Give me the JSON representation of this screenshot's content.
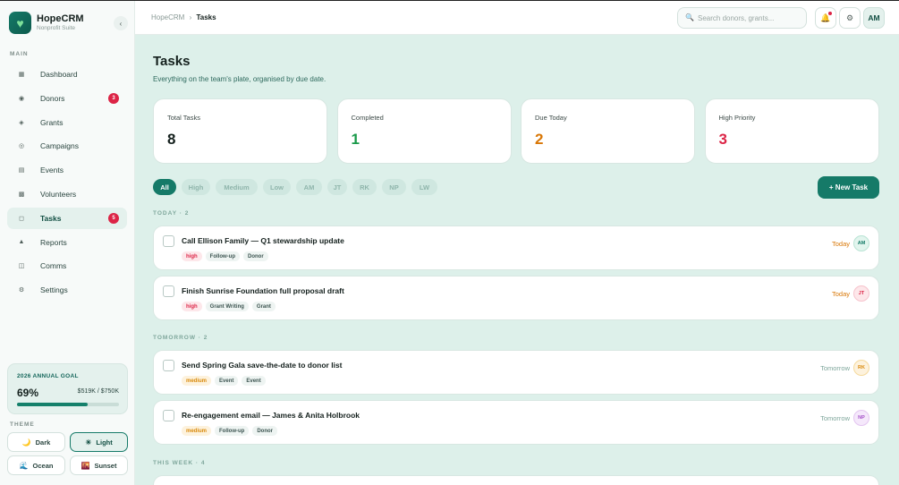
{
  "app": {
    "name": "HopeCRM",
    "subtitle": "Nonprofit Suite",
    "logo_icon": "heart-icon",
    "collapse_glyph": "‹"
  },
  "sidebar": {
    "section_label": "MAIN",
    "items": [
      {
        "label": "Dashboard",
        "icon": "▦",
        "badge": ""
      },
      {
        "label": "Donors",
        "icon": "◉",
        "badge": "3"
      },
      {
        "label": "Grants",
        "icon": "◈",
        "badge": ""
      },
      {
        "label": "Campaigns",
        "icon": "◎",
        "badge": ""
      },
      {
        "label": "Events",
        "icon": "▤",
        "badge": ""
      },
      {
        "label": "Volunteers",
        "icon": "▩",
        "badge": ""
      },
      {
        "label": "Tasks",
        "icon": "◻",
        "badge": "5"
      },
      {
        "label": "Reports",
        "icon": "▲",
        "badge": ""
      },
      {
        "label": "Comms",
        "icon": "◫",
        "badge": ""
      },
      {
        "label": "Settings",
        "icon": "⚙",
        "badge": ""
      }
    ],
    "active_item": "Tasks",
    "goal": {
      "title": "2026 ANNUAL GOAL",
      "percent": "69%",
      "amount": "$519K / $750K",
      "progress": 0.69
    },
    "theme_label": "THEME",
    "themes": [
      {
        "label": "Dark",
        "icon": "🌙",
        "selected": false
      },
      {
        "label": "Light",
        "icon": "☀",
        "selected": true
      },
      {
        "label": "Ocean",
        "icon": "🌊",
        "selected": false
      },
      {
        "label": "Sunset",
        "icon": "🌇",
        "selected": false
      }
    ]
  },
  "topbar": {
    "breadcrumb_root": "HopeCRM",
    "breadcrumb_sep": "›",
    "breadcrumb_current": "Tasks",
    "search_placeholder": "Search donors, grants...",
    "search_icon": "🔍",
    "bell_icon": "🔔",
    "settings_icon": "⚙",
    "user_initials": "AM"
  },
  "page": {
    "title": "Tasks",
    "subtitle": "Everything on the team's plate, organised by due date."
  },
  "stats": [
    {
      "label": "Total Tasks",
      "value": "8",
      "color": "#14201d"
    },
    {
      "label": "Completed",
      "value": "1",
      "color": "#1a9a4a"
    },
    {
      "label": "Due Today",
      "value": "2",
      "color": "#d97706"
    },
    {
      "label": "High Priority",
      "value": "3",
      "color": "#dc2446"
    }
  ],
  "filters": [
    "All",
    "High",
    "Medium",
    "Low",
    "AM",
    "JT",
    "RK",
    "NP",
    "LW"
  ],
  "active_filter": "All",
  "new_task_label": "+ New Task",
  "groups": [
    {
      "label": "TODAY · 2",
      "tasks": [
        {
          "title": "Call Ellison Family — Q1 stewardship update",
          "priority": "high",
          "tags": [
            "Follow-up",
            "Donor"
          ],
          "due": "Today",
          "due_color": "#d97706",
          "assignee": "AM",
          "avatar_bg": "#e2f5ee",
          "avatar_fg": "#157a68",
          "avatar_border": "#b9e3d4"
        },
        {
          "title": "Finish Sunrise Foundation full proposal draft",
          "priority": "high",
          "tags": [
            "Grant Writing",
            "Grant"
          ],
          "due": "Today",
          "due_color": "#d97706",
          "assignee": "JT",
          "avatar_bg": "#fde7ea",
          "avatar_fg": "#dc2446",
          "avatar_border": "#f6c3cc"
        }
      ]
    },
    {
      "label": "TOMORROW · 2",
      "tasks": [
        {
          "title": "Send Spring Gala save-the-date to donor list",
          "priority": "medium",
          "tags": [
            "Event",
            "Event"
          ],
          "due": "Tomorrow",
          "due_color": "#7fa79c",
          "assignee": "RK",
          "avatar_bg": "#fdf2dd",
          "avatar_fg": "#d98a0b",
          "avatar_border": "#f5d99c"
        },
        {
          "title": "Re-engagement email — James & Anita Holbrook",
          "priority": "medium",
          "tags": [
            "Follow-up",
            "Donor"
          ],
          "due": "Tomorrow",
          "due_color": "#7fa79c",
          "assignee": "NP",
          "avatar_bg": "#f5e8fb",
          "avatar_fg": "#a34fc7",
          "avatar_border": "#e3c5f0"
        }
      ]
    },
    {
      "label": "THIS WEEK · 4",
      "tasks": []
    }
  ]
}
